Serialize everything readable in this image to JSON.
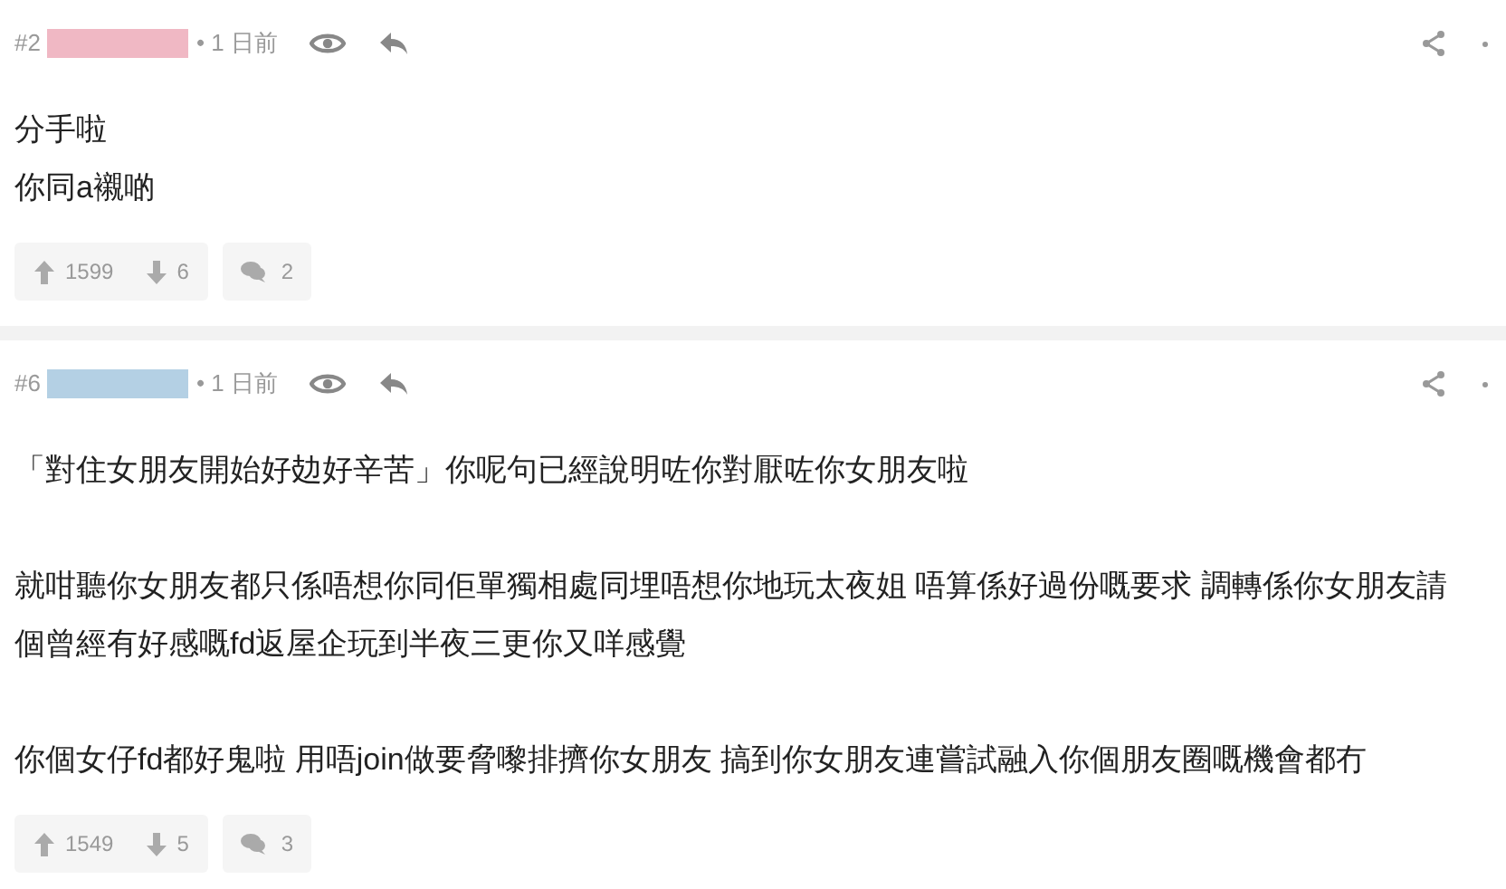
{
  "posts": [
    {
      "number": "#2",
      "color": "#f0b8c4",
      "time": "• 1 日前",
      "paragraphs": [
        {
          "lines": [
            "分手啦",
            "你同a襯啲"
          ]
        }
      ],
      "upvotes": "1599",
      "downvotes": "6",
      "replies": "2"
    },
    {
      "number": "#6",
      "color": "#b4d0e4",
      "time": "• 1 日前",
      "paragraphs": [
        {
          "lines": [
            "「對住女朋友開始好攰好辛苦」你呢句已經說明咗你對厭咗你女朋友啦"
          ]
        },
        {
          "lines": [
            "就咁聽你女朋友都只係唔想你同佢單獨相處同埋唔想你地玩太夜姐 唔算係好過份嘅要求 調轉係你女朋友請",
            "個曾經有好感嘅fd返屋企玩到半夜三更你又咩感覺"
          ]
        },
        {
          "lines": [
            "你個女仔fd都好鬼啦 用唔join做要脅嚟排擠你女朋友 搞到你女朋友連嘗試融入你個朋友圈嘅機會都冇"
          ]
        }
      ],
      "upvotes": "1549",
      "downvotes": "5",
      "replies": "3"
    }
  ]
}
